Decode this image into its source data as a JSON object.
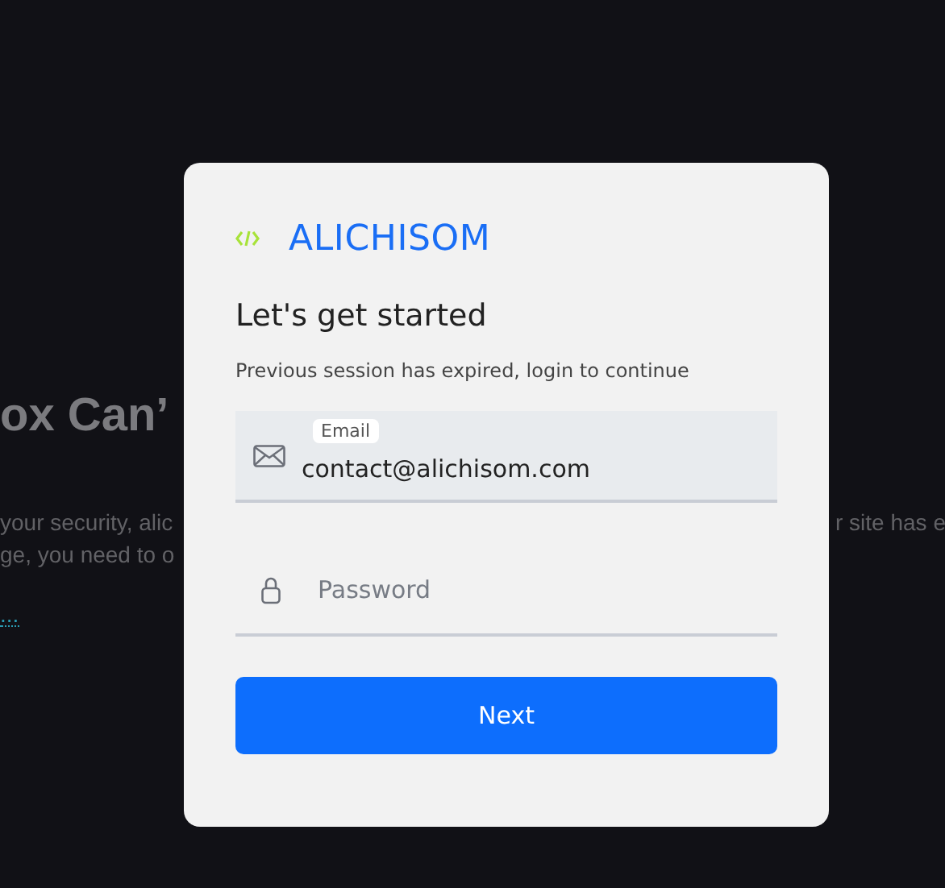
{
  "background": {
    "heading": "ox Can’",
    "paragraph_lines": [
      "your security, alic",
      "ge, you need to o"
    ],
    "paragraph_right": "r site has e",
    "link": "..."
  },
  "dialog": {
    "brand": "ALICHISOM",
    "title": "Let's get started",
    "subtitle": "Previous session has expired, login to continue",
    "email": {
      "label": "Email",
      "value": "contact@alichisom.com"
    },
    "password": {
      "placeholder": "Password"
    },
    "button": "Next"
  }
}
